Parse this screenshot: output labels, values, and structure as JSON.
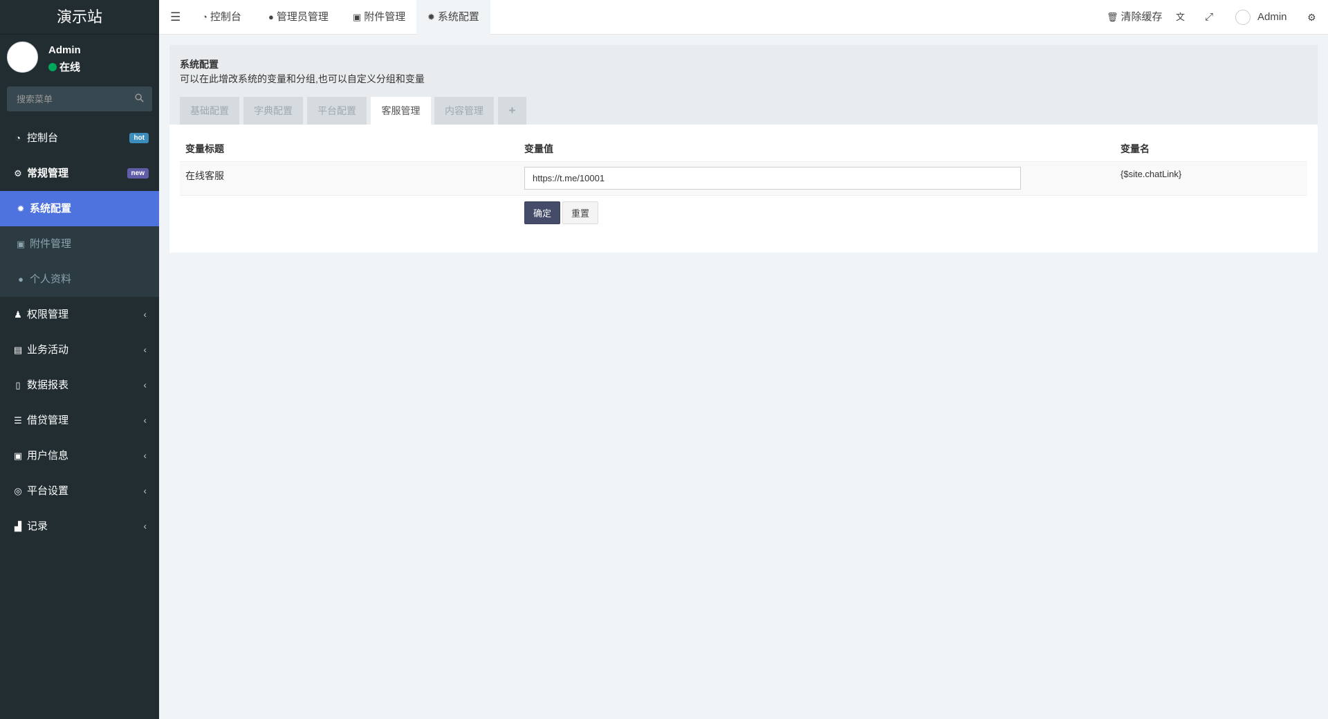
{
  "app": {
    "site_name": "演示站"
  },
  "user": {
    "name": "Admin",
    "status": "在线"
  },
  "search": {
    "placeholder": "搜索菜单"
  },
  "sidebar": {
    "items": [
      {
        "label": "控制台",
        "icon": "dashboard-icon",
        "badge": "hot",
        "badge_color": "#3c8dbc"
      },
      {
        "label": "常规管理",
        "icon": "cogs-icon",
        "badge": "new",
        "badge_color": "#605ca8"
      },
      {
        "label": "权限管理",
        "icon": "group-icon",
        "chevron": "‹"
      },
      {
        "label": "业务活动",
        "icon": "newspaper-icon",
        "chevron": "‹"
      },
      {
        "label": "数据报表",
        "icon": "file-icon",
        "chevron": "‹"
      },
      {
        "label": "借贷管理",
        "icon": "list-icon",
        "chevron": "‹"
      },
      {
        "label": "用户信息",
        "icon": "address-book-icon",
        "chevron": "‹"
      },
      {
        "label": "平台设置",
        "icon": "dot-circle-icon",
        "chevron": "‹"
      },
      {
        "label": "记录",
        "icon": "area-chart-icon",
        "chevron": "‹"
      }
    ],
    "submenu": [
      {
        "label": "系统配置",
        "icon": "gear-icon",
        "active": true
      },
      {
        "label": "附件管理",
        "icon": "image-file-icon"
      },
      {
        "label": "个人资料",
        "icon": "user-icon"
      }
    ]
  },
  "header": {
    "tabs": [
      {
        "label": "控制台",
        "icon": "dashboard-icon"
      },
      {
        "label": "管理员管理",
        "icon": "user-icon"
      },
      {
        "label": "附件管理",
        "icon": "image-file-icon"
      },
      {
        "label": "系统配置",
        "icon": "gear-icon",
        "active": true
      }
    ],
    "clear_cache": "清除缓存",
    "admin": "Admin"
  },
  "panel": {
    "title": "系统配置",
    "description": "可以在此增改系统的变量和分组,也可以自定义分组和变量",
    "tabs": [
      "基础配置",
      "字典配置",
      "平台配置",
      "客服管理",
      "内容管理",
      "+"
    ],
    "active_tab": "客服管理",
    "columns": [
      "变量标题",
      "变量值",
      "变量名"
    ],
    "rows": [
      {
        "title": "在线客服",
        "value": "https://t.me/10001",
        "name": "{$site.chatLink}"
      }
    ],
    "confirm": "确定",
    "reset": "重置"
  },
  "colors": {
    "sidebar_bg": "#222d32",
    "active": "#4e73df",
    "badge_hot": "#3c8dbc",
    "badge_new": "#605ca8",
    "online": "#00a65a"
  }
}
